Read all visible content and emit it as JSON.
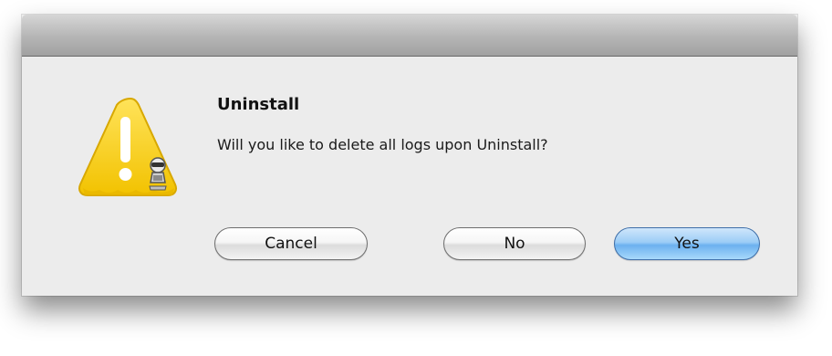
{
  "dialog": {
    "title": "Uninstall",
    "message": "Will you like to delete all logs upon Uninstall?",
    "icon": "caution-icon",
    "buttons": {
      "cancel": "Cancel",
      "no": "No",
      "yes": "Yes"
    },
    "default_button": "yes",
    "colors": {
      "caution_yellow": "#f7cc17",
      "default_button_blue": "#6cb1ef",
      "dialog_bg": "#ececec"
    }
  }
}
